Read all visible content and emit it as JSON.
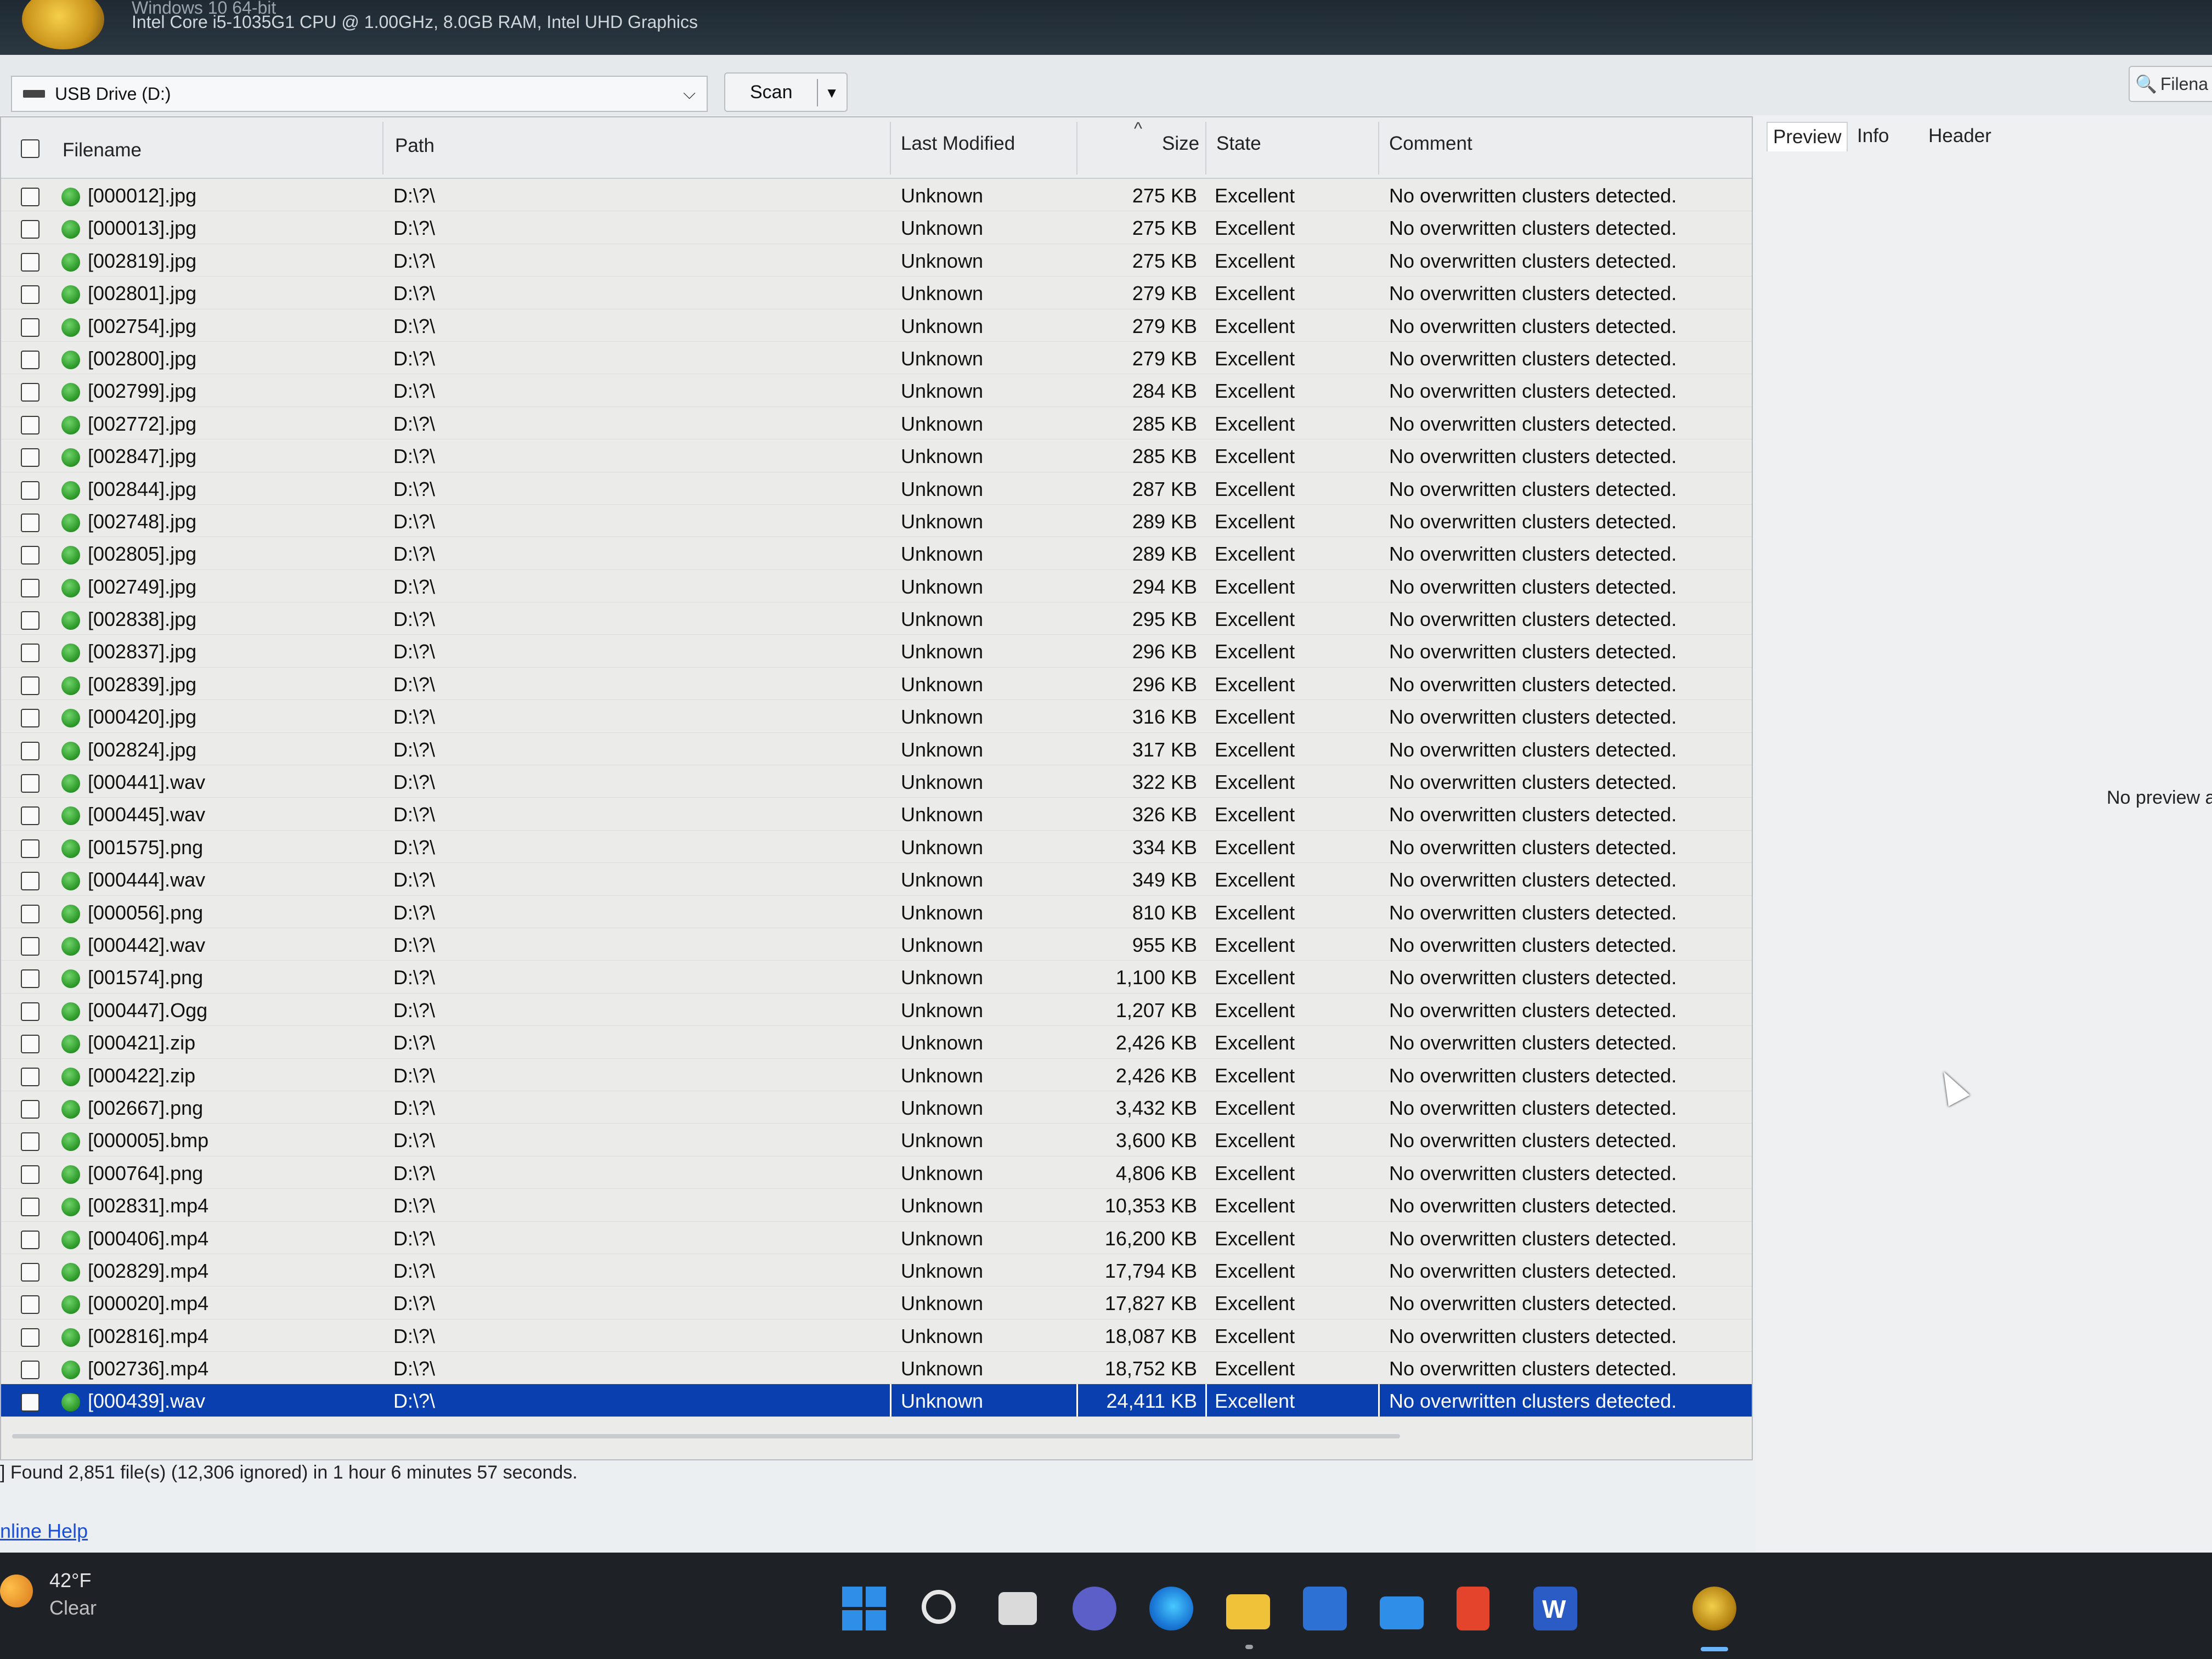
{
  "window": {
    "system_line1": "Windows 10 64-bit",
    "system_line2": "Intel Core i5-1035G1 CPU @ 1.00GHz, 8.0GB RAM, Intel UHD Graphics"
  },
  "toolbar": {
    "drive": "USB Drive (D:)",
    "scan_label": "Scan",
    "filename_search_label": "Filena"
  },
  "table": {
    "columns": {
      "filename": "Filename",
      "path": "Path",
      "last_modified": "Last Modified",
      "size": "Size",
      "state": "State",
      "comment": "Comment"
    },
    "rows": [
      {
        "name": "[000012].jpg",
        "path": "D:\\?\\",
        "modified": "Unknown",
        "size": "275 KB",
        "state": "Excellent",
        "comment": "No overwritten clusters detected."
      },
      {
        "name": "[000013].jpg",
        "path": "D:\\?\\",
        "modified": "Unknown",
        "size": "275 KB",
        "state": "Excellent",
        "comment": "No overwritten clusters detected."
      },
      {
        "name": "[002819].jpg",
        "path": "D:\\?\\",
        "modified": "Unknown",
        "size": "275 KB",
        "state": "Excellent",
        "comment": "No overwritten clusters detected."
      },
      {
        "name": "[002801].jpg",
        "path": "D:\\?\\",
        "modified": "Unknown",
        "size": "279 KB",
        "state": "Excellent",
        "comment": "No overwritten clusters detected."
      },
      {
        "name": "[002754].jpg",
        "path": "D:\\?\\",
        "modified": "Unknown",
        "size": "279 KB",
        "state": "Excellent",
        "comment": "No overwritten clusters detected."
      },
      {
        "name": "[002800].jpg",
        "path": "D:\\?\\",
        "modified": "Unknown",
        "size": "279 KB",
        "state": "Excellent",
        "comment": "No overwritten clusters detected."
      },
      {
        "name": "[002799].jpg",
        "path": "D:\\?\\",
        "modified": "Unknown",
        "size": "284 KB",
        "state": "Excellent",
        "comment": "No overwritten clusters detected."
      },
      {
        "name": "[002772].jpg",
        "path": "D:\\?\\",
        "modified": "Unknown",
        "size": "285 KB",
        "state": "Excellent",
        "comment": "No overwritten clusters detected."
      },
      {
        "name": "[002847].jpg",
        "path": "D:\\?\\",
        "modified": "Unknown",
        "size": "285 KB",
        "state": "Excellent",
        "comment": "No overwritten clusters detected."
      },
      {
        "name": "[002844].jpg",
        "path": "D:\\?\\",
        "modified": "Unknown",
        "size": "287 KB",
        "state": "Excellent",
        "comment": "No overwritten clusters detected."
      },
      {
        "name": "[002748].jpg",
        "path": "D:\\?\\",
        "modified": "Unknown",
        "size": "289 KB",
        "state": "Excellent",
        "comment": "No overwritten clusters detected."
      },
      {
        "name": "[002805].jpg",
        "path": "D:\\?\\",
        "modified": "Unknown",
        "size": "289 KB",
        "state": "Excellent",
        "comment": "No overwritten clusters detected."
      },
      {
        "name": "[002749].jpg",
        "path": "D:\\?\\",
        "modified": "Unknown",
        "size": "294 KB",
        "state": "Excellent",
        "comment": "No overwritten clusters detected."
      },
      {
        "name": "[002838].jpg",
        "path": "D:\\?\\",
        "modified": "Unknown",
        "size": "295 KB",
        "state": "Excellent",
        "comment": "No overwritten clusters detected."
      },
      {
        "name": "[002837].jpg",
        "path": "D:\\?\\",
        "modified": "Unknown",
        "size": "296 KB",
        "state": "Excellent",
        "comment": "No overwritten clusters detected."
      },
      {
        "name": "[002839].jpg",
        "path": "D:\\?\\",
        "modified": "Unknown",
        "size": "296 KB",
        "state": "Excellent",
        "comment": "No overwritten clusters detected."
      },
      {
        "name": "[000420].jpg",
        "path": "D:\\?\\",
        "modified": "Unknown",
        "size": "316 KB",
        "state": "Excellent",
        "comment": "No overwritten clusters detected."
      },
      {
        "name": "[002824].jpg",
        "path": "D:\\?\\",
        "modified": "Unknown",
        "size": "317 KB",
        "state": "Excellent",
        "comment": "No overwritten clusters detected."
      },
      {
        "name": "[000441].wav",
        "path": "D:\\?\\",
        "modified": "Unknown",
        "size": "322 KB",
        "state": "Excellent",
        "comment": "No overwritten clusters detected."
      },
      {
        "name": "[000445].wav",
        "path": "D:\\?\\",
        "modified": "Unknown",
        "size": "326 KB",
        "state": "Excellent",
        "comment": "No overwritten clusters detected."
      },
      {
        "name": "[001575].png",
        "path": "D:\\?\\",
        "modified": "Unknown",
        "size": "334 KB",
        "state": "Excellent",
        "comment": "No overwritten clusters detected."
      },
      {
        "name": "[000444].wav",
        "path": "D:\\?\\",
        "modified": "Unknown",
        "size": "349 KB",
        "state": "Excellent",
        "comment": "No overwritten clusters detected."
      },
      {
        "name": "[000056].png",
        "path": "D:\\?\\",
        "modified": "Unknown",
        "size": "810 KB",
        "state": "Excellent",
        "comment": "No overwritten clusters detected."
      },
      {
        "name": "[000442].wav",
        "path": "D:\\?\\",
        "modified": "Unknown",
        "size": "955 KB",
        "state": "Excellent",
        "comment": "No overwritten clusters detected."
      },
      {
        "name": "[001574].png",
        "path": "D:\\?\\",
        "modified": "Unknown",
        "size": "1,100 KB",
        "state": "Excellent",
        "comment": "No overwritten clusters detected."
      },
      {
        "name": "[000447].Ogg",
        "path": "D:\\?\\",
        "modified": "Unknown",
        "size": "1,207 KB",
        "state": "Excellent",
        "comment": "No overwritten clusters detected."
      },
      {
        "name": "[000421].zip",
        "path": "D:\\?\\",
        "modified": "Unknown",
        "size": "2,426 KB",
        "state": "Excellent",
        "comment": "No overwritten clusters detected."
      },
      {
        "name": "[000422].zip",
        "path": "D:\\?\\",
        "modified": "Unknown",
        "size": "2,426 KB",
        "state": "Excellent",
        "comment": "No overwritten clusters detected."
      },
      {
        "name": "[002667].png",
        "path": "D:\\?\\",
        "modified": "Unknown",
        "size": "3,432 KB",
        "state": "Excellent",
        "comment": "No overwritten clusters detected."
      },
      {
        "name": "[000005].bmp",
        "path": "D:\\?\\",
        "modified": "Unknown",
        "size": "3,600 KB",
        "state": "Excellent",
        "comment": "No overwritten clusters detected."
      },
      {
        "name": "[000764].png",
        "path": "D:\\?\\",
        "modified": "Unknown",
        "size": "4,806 KB",
        "state": "Excellent",
        "comment": "No overwritten clusters detected."
      },
      {
        "name": "[002831].mp4",
        "path": "D:\\?\\",
        "modified": "Unknown",
        "size": "10,353 KB",
        "state": "Excellent",
        "comment": "No overwritten clusters detected."
      },
      {
        "name": "[000406].mp4",
        "path": "D:\\?\\",
        "modified": "Unknown",
        "size": "16,200 KB",
        "state": "Excellent",
        "comment": "No overwritten clusters detected."
      },
      {
        "name": "[002829].mp4",
        "path": "D:\\?\\",
        "modified": "Unknown",
        "size": "17,794 KB",
        "state": "Excellent",
        "comment": "No overwritten clusters detected."
      },
      {
        "name": "[000020].mp4",
        "path": "D:\\?\\",
        "modified": "Unknown",
        "size": "17,827 KB",
        "state": "Excellent",
        "comment": "No overwritten clusters detected."
      },
      {
        "name": "[002816].mp4",
        "path": "D:\\?\\",
        "modified": "Unknown",
        "size": "18,087 KB",
        "state": "Excellent",
        "comment": "No overwritten clusters detected."
      },
      {
        "name": "[002736].mp4",
        "path": "D:\\?\\",
        "modified": "Unknown",
        "size": "18,752 KB",
        "state": "Excellent",
        "comment": "No overwritten clusters detected."
      },
      {
        "name": "[000439].wav",
        "path": "D:\\?\\",
        "modified": "Unknown",
        "size": "24,411 KB",
        "state": "Excellent",
        "comment": "No overwritten clusters detected.",
        "selected": true
      }
    ]
  },
  "preview_panel": {
    "tabs": [
      "Preview",
      "Info",
      "Header"
    ],
    "active_tab": "Preview",
    "message": "No preview a"
  },
  "status": {
    "text": "] Found 2,851 file(s) (12,306 ignored) in 1 hour 6 minutes 57 seconds.",
    "help_link": "nline Help"
  },
  "taskbar": {
    "weather_temp": "42°F",
    "weather_cond": "Clear",
    "word_letter": "W"
  },
  "colors": {
    "selection": "#0a3fb0",
    "status_ok": "#2e9a2a",
    "link": "#1a4fd6"
  }
}
